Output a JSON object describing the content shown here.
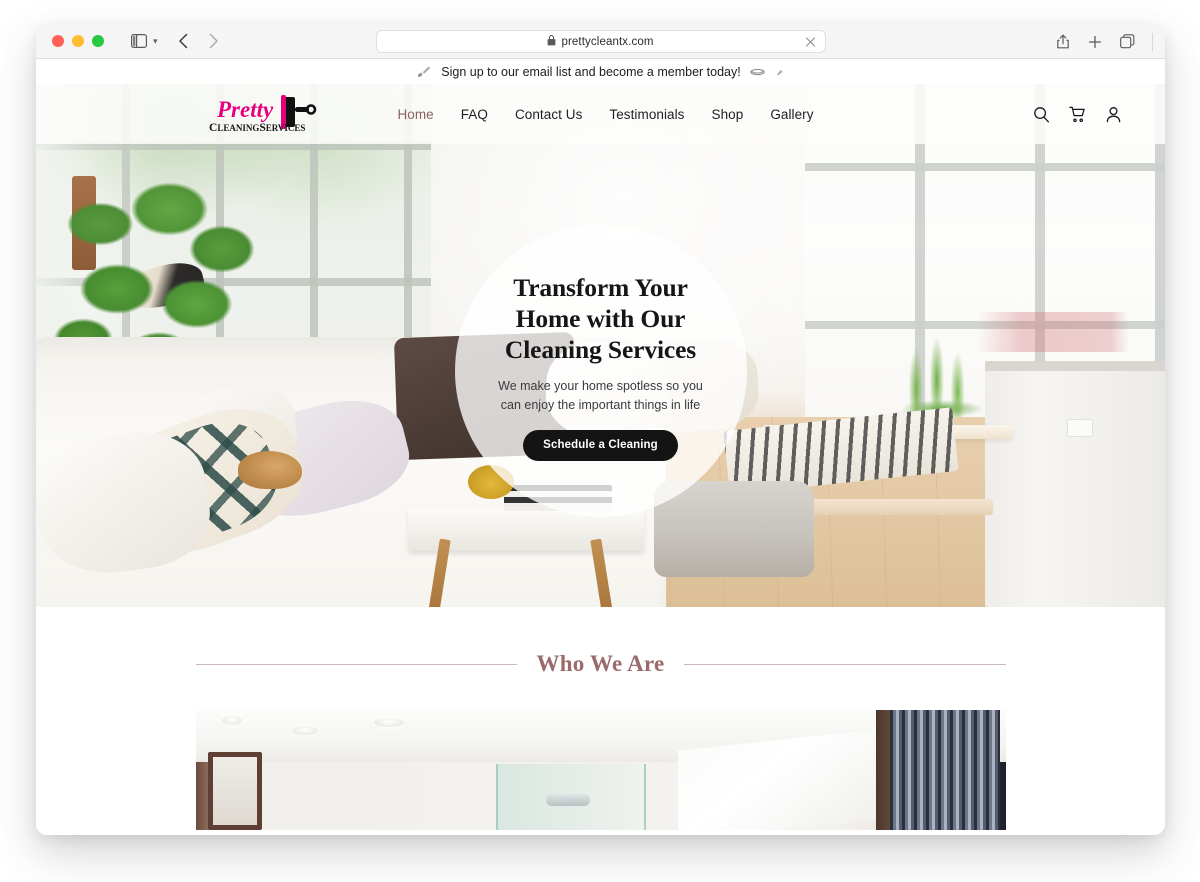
{
  "browser": {
    "window_controls": [
      "close",
      "minimize",
      "maximize"
    ],
    "sidebar_toggle_name": "sidebar-toggle",
    "back_label": "‹",
    "forward_label": "›",
    "address": {
      "url": "prettycleantx.com",
      "secure_icon": "lock-icon",
      "clear_label": "✕"
    },
    "toolbar_right": [
      "share-icon",
      "new-tab-icon",
      "tab-overview-icon"
    ]
  },
  "site": {
    "announcement": {
      "left_deco": "cleaning-spray-emoji",
      "text": "Sign up to our email list and become a member today!",
      "right_deco_1": "squeegee-emoji",
      "right_deco_2": "brush-emoji"
    },
    "logo": {
      "script_text": "Pretty",
      "sub_text": "CleaningServices",
      "accent_color": "#e6007e"
    },
    "nav": {
      "items": [
        {
          "label": "Home",
          "active": true
        },
        {
          "label": "FAQ",
          "active": false
        },
        {
          "label": "Contact Us",
          "active": false
        },
        {
          "label": "Testimonials",
          "active": false
        },
        {
          "label": "Shop",
          "active": false
        },
        {
          "label": "Gallery",
          "active": false
        }
      ],
      "active_color": "#8d5f5f",
      "icons": [
        "search-icon",
        "cart-icon",
        "account-icon"
      ]
    },
    "hero": {
      "title_line_1": "Transform Your",
      "title_line_2": "Home with Our",
      "title_line_3": "Cleaning Services",
      "subtitle_line_1": "We make your home spotless so you",
      "subtitle_line_2": "can enjoy the important things in life",
      "cta_label": "Schedule a Cleaning",
      "cta_bg": "#141414",
      "cta_text_color": "#ffffff"
    },
    "who_we_are": {
      "title": "Who We Are",
      "title_color": "#9b6a6a",
      "rule_color": "#c9b9b9",
      "image_alt": "bathroom-interior-photo"
    }
  }
}
